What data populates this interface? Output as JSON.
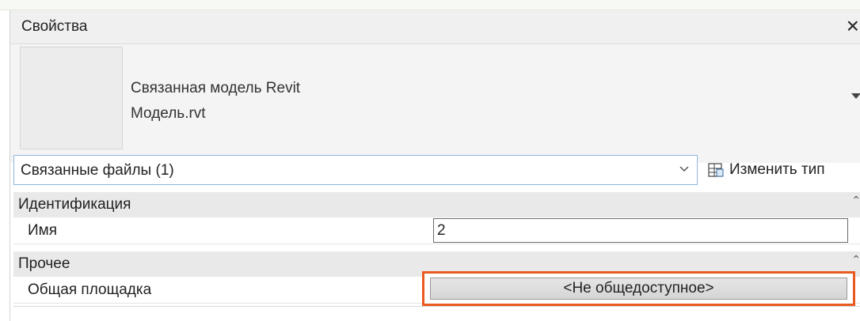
{
  "titlebar": {
    "title": "Свойства",
    "close_icon": "×"
  },
  "type_selector": {
    "preview": "",
    "type_line1": "Связанная модель Revit",
    "type_line2": "Модель.rvt"
  },
  "instance_filter": {
    "selected": "Связанные файлы (1)"
  },
  "edit_type": {
    "label": "Изменить тип",
    "icon": "edit-type-icon"
  },
  "sections": [
    {
      "label": "Идентификация",
      "rows": [
        {
          "label": "Имя",
          "value": "2"
        }
      ]
    },
    {
      "label": "Прочее",
      "rows": [
        {
          "label": "Общая площадка",
          "value": "<Не общедоступное>"
        }
      ]
    }
  ],
  "colors": {
    "highlight": "#ea5a20",
    "selector_border": "#8fb6dc"
  }
}
